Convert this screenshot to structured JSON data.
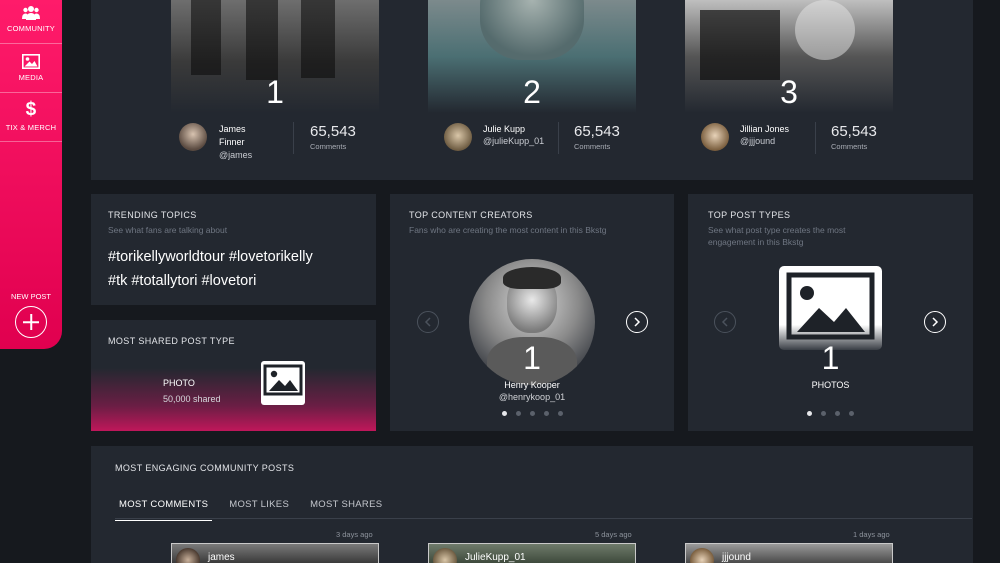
{
  "sidebar": {
    "items": [
      {
        "label": "COMMUNITY",
        "icon": "community-icon"
      },
      {
        "label": "MEDIA",
        "icon": "image-icon"
      },
      {
        "label": "TIX & MERCH",
        "icon": "dollar-icon"
      }
    ],
    "new_post_label": "NEW POST",
    "accent_color": "#ff1b6a"
  },
  "leaderboard": [
    {
      "rank": "1",
      "name": "James Finner",
      "handle": "@james",
      "count": "65,543",
      "count_label": "Comments"
    },
    {
      "rank": "2",
      "name": "Julie Kupp",
      "handle": "@julieKupp_01",
      "count": "65,543",
      "count_label": "Comments"
    },
    {
      "rank": "3",
      "name": "Jillian Jones",
      "handle": "@jjjound",
      "count": "65,543",
      "count_label": "Comments"
    }
  ],
  "trending": {
    "title": "TRENDING TOPICS",
    "subtitle": "See what fans are talking about",
    "tags_line1": "#torikellyworldtour #lovetorikelly",
    "tags_line2": "#tk #totallytori #lovetori"
  },
  "most_shared": {
    "title": "MOST SHARED POST TYPE",
    "type": "PHOTO",
    "count": "50,000 shared"
  },
  "top_creators": {
    "title": "TOP CONTENT CREATORS",
    "subtitle": "Fans who are creating the most content in this Bkstg",
    "rank": "1",
    "name": "Henry Kooper",
    "handle": "@henrykoop_01",
    "page_count": 5,
    "active_page": 1
  },
  "top_post_types": {
    "title": "TOP POST TYPES",
    "subtitle_line1": "See what post type creates the most",
    "subtitle_line2": "engagement in this Bkstg",
    "rank": "1",
    "type": "PHOTOS",
    "page_count": 4,
    "active_page": 1
  },
  "engaging": {
    "title": "MOST ENGAGING COMMUNITY POSTS",
    "tabs": [
      "MOST COMMENTS",
      "MOST LIKES",
      "MOST SHARES"
    ],
    "active_tab": 0,
    "posts": [
      {
        "ago": "3 days ago",
        "name": "james"
      },
      {
        "ago": "5 days ago",
        "name": "JulieKupp_01"
      },
      {
        "ago": "1 days ago",
        "name": "jjjound"
      }
    ]
  }
}
